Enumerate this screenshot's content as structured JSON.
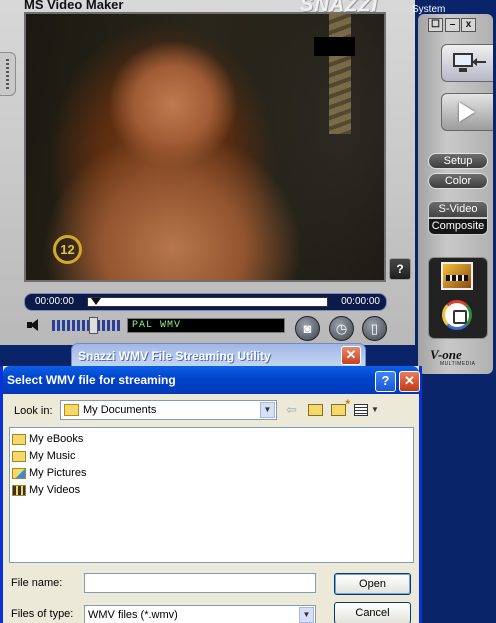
{
  "video_maker": {
    "title": "MS Video Maker",
    "logo_text": "SNAZZI",
    "system_label": "System",
    "channel_badge": "12",
    "help_label": "?",
    "time_start": "00:00:00",
    "time_end": "00:00:00",
    "format_readout": "PAL WMV",
    "window_buttons": {
      "restore": "☐",
      "minimize": "–",
      "close": "x"
    },
    "setup_label": "Setup",
    "color_label": "Color",
    "svideo_label": "S-Video",
    "composite_label": "Composite",
    "brand_text": "V-one",
    "brand_sub": "MULTIMEDIA"
  },
  "snazzi": {
    "title": "Snazzi WMV File Streaming Utility",
    "close_label": "✕"
  },
  "dialog": {
    "title": "Select WMV file for streaming",
    "help_label": "?",
    "close_label": "✕",
    "look_in_label": "Look in:",
    "look_in_value": "My Documents",
    "items": [
      {
        "name": "My eBooks"
      },
      {
        "name": "My Music"
      },
      {
        "name": "My Pictures"
      },
      {
        "name": "My Videos"
      }
    ],
    "file_name_label": "File name:",
    "file_name_value": "",
    "file_type_label": "Files of type:",
    "file_type_value": "WMV files (*.wmv)",
    "open_label": "Open",
    "cancel_label": "Cancel"
  },
  "colors": {
    "xp_title_blue": "#0244c9",
    "dialog_face": "#ece9d8",
    "format_text": "#8cf08c",
    "badge_gold": "#d4aa21"
  }
}
